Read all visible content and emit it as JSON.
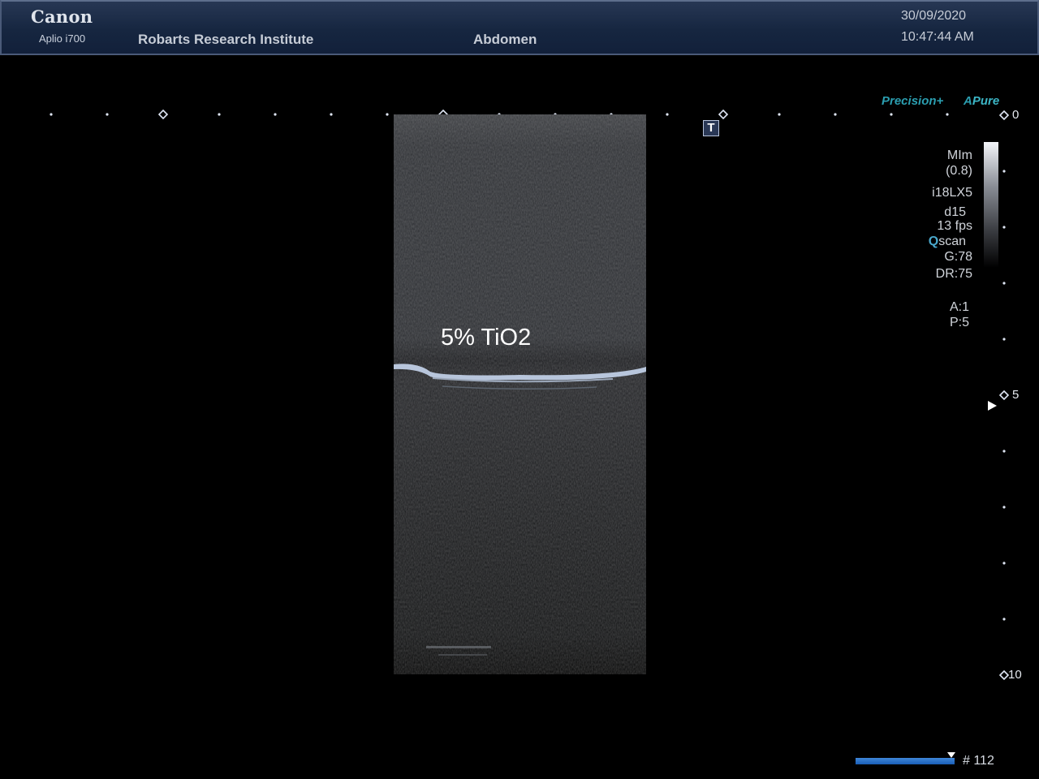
{
  "header": {
    "brand": "Canon",
    "model": "Aplio i700",
    "institution": "Robarts Research Institute",
    "preset": "Abdomen",
    "date": "30/09/2020",
    "time": "10:47:44 AM"
  },
  "image": {
    "annotation": "5% TiO2",
    "text_marker": "T"
  },
  "modes": {
    "precision": "Precision+",
    "apure_a": "A",
    "apure_pure": "Pure"
  },
  "params": {
    "mi": "MIm",
    "mi_value": "(0.8)",
    "probe": "i18LX5",
    "depth": "d15",
    "fps": "13 fps",
    "qscan_q": "Q",
    "qscan_rest": "scan",
    "gain": "G:78",
    "dr": "DR:75",
    "a": "A:1",
    "p": "P:5"
  },
  "depth_scale": {
    "top": "0",
    "mid": "5",
    "bottom": "10"
  },
  "cine": {
    "frame": "# 112"
  },
  "colors": {
    "header_bg": "#1a2a46",
    "accent_teal": "#2b9eb0",
    "frame_bar": "#2a6fc8"
  }
}
